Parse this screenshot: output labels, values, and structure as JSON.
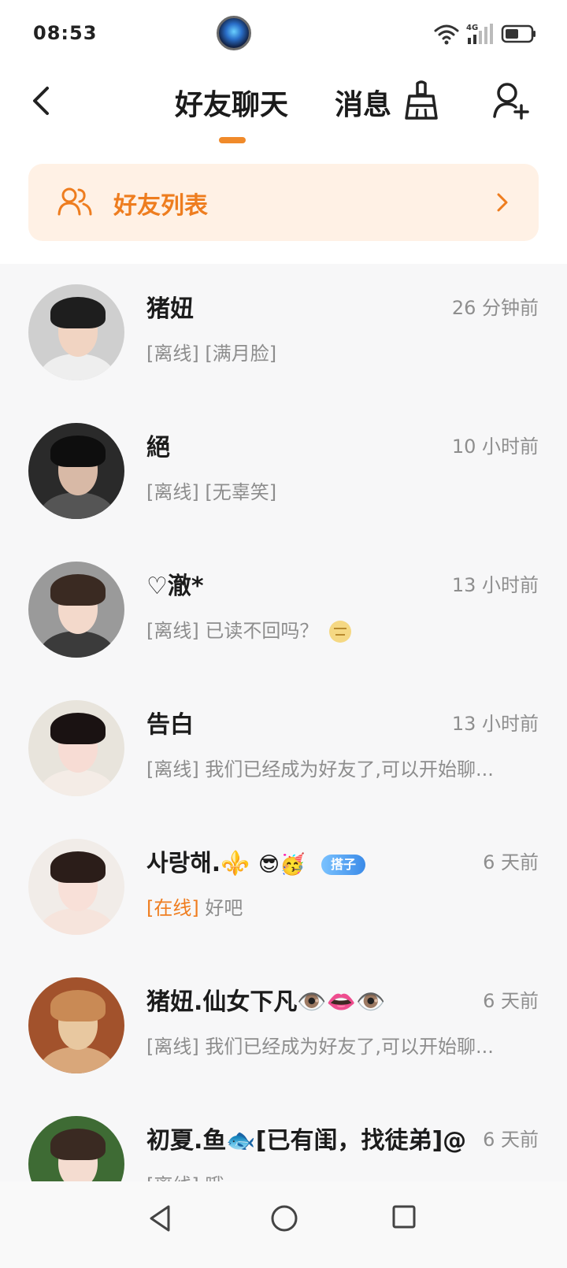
{
  "status_bar": {
    "time": "08:53",
    "network_label": "4G",
    "icons": [
      "app-icon",
      "wifi-icon",
      "signal-icon",
      "battery-icon"
    ]
  },
  "header": {
    "tab_friends": "好友聊天",
    "tab_messages": "消息",
    "icons": [
      "back-icon",
      "broom-icon",
      "add-friend-icon"
    ]
  },
  "banner": {
    "label": "好友列表",
    "icons": [
      "people-icon",
      "chevron-right-icon"
    ]
  },
  "conversations": [
    {
      "name": "猪妞",
      "time": "26 分钟前",
      "status": "[离线]",
      "preview": "[满月脸]"
    },
    {
      "name": "絕",
      "time": "10 小时前",
      "status": "[离线]",
      "preview": "[无辜笑]"
    },
    {
      "name": "♡澈*",
      "time": "13 小时前",
      "status": "[离线]",
      "preview": "已读不回吗？"
    },
    {
      "name": "告白",
      "time": "13 小时前",
      "status": "[离线]",
      "preview": "我们已经成为好友了,可以开始聊..."
    },
    {
      "name": "사랑해.⚜️",
      "emoji": "😎🥳",
      "tag": "搭子",
      "time": "6 天前",
      "status": "[在线]",
      "preview": "好吧"
    },
    {
      "name": "猪妞.仙女下凡👁️👄👁️",
      "time": "6 天前",
      "status": "[离线]",
      "preview": "我们已经成为好友了,可以开始聊..."
    },
    {
      "name": "初夏.鱼🐟[已有闺，找徒弟]@",
      "time": "6 天前",
      "status": "[离线]",
      "preview": "哦"
    }
  ],
  "nav_bar": {
    "icons": [
      "nav-back-icon",
      "nav-home-icon",
      "nav-recent-icon"
    ]
  },
  "colors": {
    "accent": "#ef7d1f",
    "banner_bg": "#fff1e5",
    "muted_text": "#8d8d8d",
    "list_bg": "#f7f7f8"
  }
}
